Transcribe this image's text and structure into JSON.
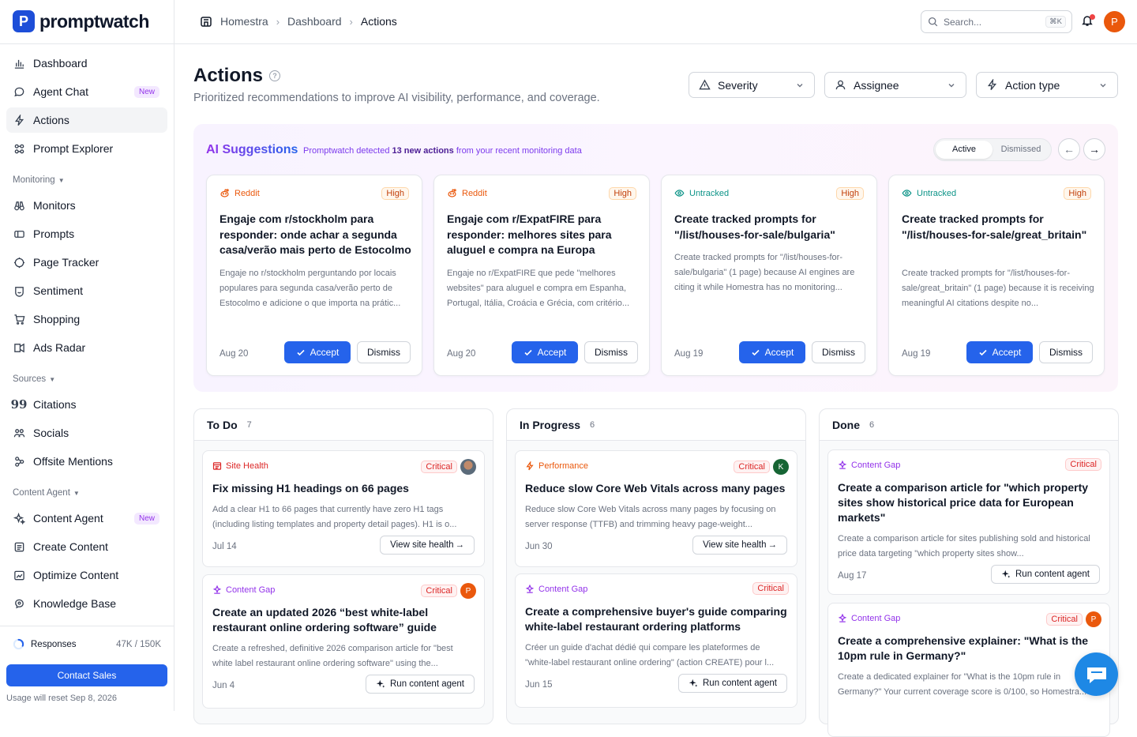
{
  "brand": {
    "name": "promptwatch",
    "mark": "P"
  },
  "sidebar": {
    "items": [
      {
        "label": "Dashboard",
        "icon": "bar-chart-icon"
      },
      {
        "label": "Agent Chat",
        "icon": "chat-icon",
        "badge": "New"
      },
      {
        "label": "Actions",
        "icon": "bolt-icon",
        "active": true
      },
      {
        "label": "Prompt Explorer",
        "icon": "explorer-icon"
      }
    ],
    "monitoring_label": "Monitoring",
    "monitoring": [
      {
        "label": "Monitors",
        "icon": "binoculars-icon"
      },
      {
        "label": "Prompts",
        "icon": "prompts-icon"
      },
      {
        "label": "Page Tracker",
        "icon": "page-tracker-icon"
      },
      {
        "label": "Sentiment",
        "icon": "sentiment-icon"
      },
      {
        "label": "Shopping",
        "icon": "cart-icon"
      },
      {
        "label": "Ads Radar",
        "icon": "ads-radar-icon"
      }
    ],
    "sources_label": "Sources",
    "sources": [
      {
        "label": "Citations",
        "icon": "quote-icon"
      },
      {
        "label": "Socials",
        "icon": "socials-icon"
      },
      {
        "label": "Offsite Mentions",
        "icon": "mentions-icon"
      }
    ],
    "content_label": "Content Agent",
    "content": [
      {
        "label": "Content Agent",
        "icon": "sparkle-icon",
        "badge": "New"
      },
      {
        "label": "Create Content",
        "icon": "create-content-icon"
      },
      {
        "label": "Optimize Content",
        "icon": "optimize-icon"
      },
      {
        "label": "Knowledge Base",
        "icon": "knowledge-icon"
      }
    ],
    "responses_label": "Responses",
    "responses_count": "47K / 150K",
    "responses_fraction": 0.31,
    "contact_label": "Contact Sales",
    "reset_text": "Usage will reset Sep 8, 2026"
  },
  "topbar": {
    "breadcrumb": [
      "Homestra",
      "Dashboard",
      "Actions"
    ],
    "search_placeholder": "Search...",
    "search_shortcut": "⌘K",
    "avatar": "P"
  },
  "page": {
    "title": "Actions",
    "subtitle": "Prioritized recommendations to improve AI visibility, performance, and coverage.",
    "filters": [
      {
        "label": "Severity",
        "icon": "warning-icon"
      },
      {
        "label": "Assignee",
        "icon": "user-icon"
      },
      {
        "label": "Action type",
        "icon": "bolt-icon"
      }
    ]
  },
  "suggestions": {
    "title": "AI Suggestions",
    "desc_pre": "Promptwatch detected",
    "desc_bold": "13 new actions",
    "desc_post": "from your recent monitoring data",
    "tabs": [
      "Active",
      "Dismissed"
    ],
    "active_tab": "Active",
    "accept_label": "Accept",
    "dismiss_label": "Dismiss",
    "cards": [
      {
        "source": "Reddit",
        "source_type": "reddit",
        "priority": "High",
        "title": "Engaje com r/stockholm para responder: onde achar a segunda casa/verão mais perto de Estocolmo",
        "body": "Engaje no r/stockholm perguntando por locais populares para segunda casa/verão perto de Estocolmo e adicione o que importa na prátic...",
        "date": "Aug 20"
      },
      {
        "source": "Reddit",
        "source_type": "reddit",
        "priority": "High",
        "title": "Engaje com r/ExpatFIRE para responder: melhores sites para aluguel e compra na Europa",
        "body": "Engaje no r/ExpatFIRE que pede \"melhores websites\" para aluguel e compra em Espanha, Portugal, Itália, Croácia e Grécia, com critério...",
        "date": "Aug 20"
      },
      {
        "source": "Untracked",
        "source_type": "untracked",
        "priority": "High",
        "title": "Create tracked prompts for \"/list/houses-for-sale/bulgaria\"",
        "body": "Create tracked prompts for \"/list/houses-for-sale/bulgaria\" (1 page) because AI engines are citing it while Homestra has no monitoring...",
        "date": "Aug 19"
      },
      {
        "source": "Untracked",
        "source_type": "untracked",
        "priority": "High",
        "title": "Create tracked prompts for \"/list/houses-for-sale/great_britain\"",
        "body": "Create tracked prompts for \"/list/houses-for-sale/great_britain\" (1 page) because it is receiving meaningful AI citations despite no...",
        "date": "Aug 19"
      }
    ]
  },
  "board": {
    "columns": [
      {
        "title": "To Do",
        "count": "7",
        "tasks": [
          {
            "category": "Site Health",
            "cat_type": "site",
            "priority": "Critical",
            "assignee": "photo",
            "title": "Fix missing H1 headings on 66 pages",
            "body": "Add a clear H1 to 66 pages that currently have zero H1 tags (including listing templates and property detail pages). H1 is o...",
            "date": "Jul 14",
            "action": "View site health"
          },
          {
            "category": "Content Gap",
            "cat_type": "content",
            "priority": "Critical",
            "assignee": "P",
            "title": "Create an updated 2026 “best white-label restaurant online ordering software” guide",
            "body": "Create a refreshed, definitive 2026 comparison article for \"best white label restaurant online ordering software\" using the...",
            "date": "Jun 4",
            "action": "Run content agent"
          }
        ]
      },
      {
        "title": "In Progress",
        "count": "6",
        "tasks": [
          {
            "category": "Performance",
            "cat_type": "perf",
            "priority": "Critical",
            "assignee": "K",
            "title": "Reduce slow Core Web Vitals across many pages",
            "body": "Reduce slow Core Web Vitals across many pages by focusing on server response (TTFB) and trimming heavy page-weight...",
            "date": "Jun 30",
            "action": "View site health"
          },
          {
            "category": "Content Gap",
            "cat_type": "content",
            "priority": "Critical",
            "assignee": "",
            "title": "Create a comprehensive buyer's guide comparing white-label restaurant ordering platforms",
            "body": "Créer un guide d'achat dédié qui compare les plateformes de \"white-label restaurant online ordering\" (action CREATE) pour l...",
            "date": "Jun 15",
            "action": "Run content agent"
          }
        ]
      },
      {
        "title": "Done",
        "count": "6",
        "tasks": [
          {
            "category": "Content Gap",
            "cat_type": "content",
            "priority": "Critical",
            "assignee": "",
            "title": "Create a comparison article for \"which property sites show historical price data for European markets\"",
            "body": "Create a comparison article for sites publishing sold and historical price data targeting \"which property sites show...",
            "date": "Aug 17",
            "action": "Run content agent"
          },
          {
            "category": "Content Gap",
            "cat_type": "content",
            "priority": "Critical",
            "assignee": "P",
            "title": "Create a comprehensive explainer: \"What is the 10pm rule in Germany?\"",
            "body": "Create a dedicated explainer for \"What is the 10pm rule in Germany?\" Your current coverage score is 0/100, so Homestra...",
            "date": "",
            "action": ""
          }
        ]
      }
    ]
  },
  "colors": {
    "accent": "#2563eb",
    "brand": "#1d4ed8",
    "critical": "#dc2626",
    "high": "#c2410c",
    "reddit": "#ea580c",
    "untracked": "#0d9488",
    "content_gap": "#9333ea",
    "site_health": "#dc2626",
    "performance": "#ea580c"
  }
}
